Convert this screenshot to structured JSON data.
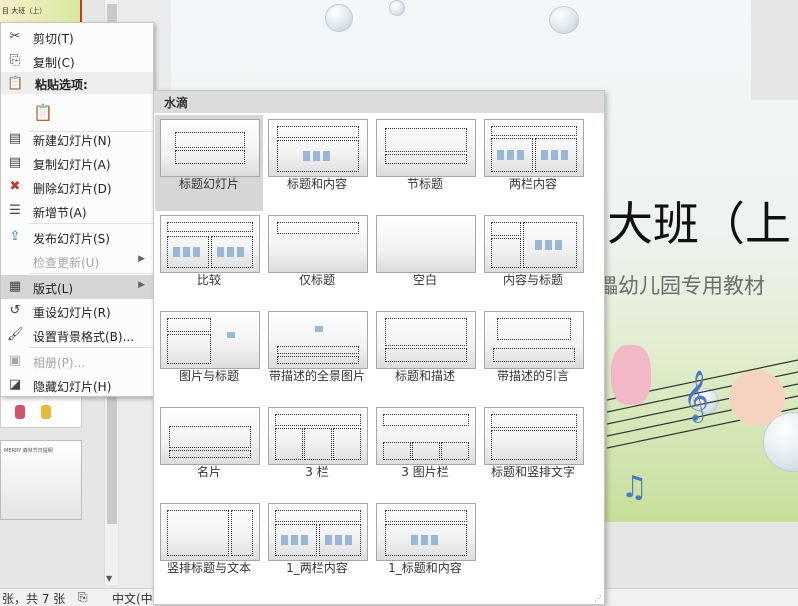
{
  "thumbnail_pane": {
    "top_thumb_text": "目  大班（上）",
    "slide7_thumb_text": "MERRY 森林节日提纲"
  },
  "slide": {
    "title": "大班（上",
    "subtitle": "儡幼儿园专用教材"
  },
  "statusbar": {
    "slide_count": "张，共 7 张",
    "language": "中文(中"
  },
  "context_menu": {
    "items": [
      {
        "label": "剪切(T)",
        "icon": "scissors-icon",
        "enabled": true
      },
      {
        "label": "复制(C)",
        "icon": "copy-icon",
        "enabled": true
      },
      {
        "label": "粘贴选项:",
        "icon": "paste-icon",
        "enabled": false
      },
      {
        "label": "新建幻灯片(N)",
        "icon": "new-slide-icon",
        "enabled": true
      },
      {
        "label": "复制幻灯片(A)",
        "icon": "duplicate-slide-icon",
        "enabled": true
      },
      {
        "label": "删除幻灯片(D)",
        "icon": "delete-slide-icon",
        "enabled": true
      },
      {
        "label": "新增节(A)",
        "icon": "add-section-icon",
        "enabled": true
      },
      {
        "label": "发布幻灯片(S)",
        "icon": "publish-slides-icon",
        "enabled": true
      },
      {
        "label": "检查更新(U)",
        "icon": "",
        "enabled": false
      },
      {
        "label": "版式(L)",
        "icon": "layout-icon",
        "enabled": true
      },
      {
        "label": "重设幻灯片(R)",
        "icon": "reset-slide-icon",
        "enabled": true
      },
      {
        "label": "设置背景格式(B)...",
        "icon": "format-background-icon",
        "enabled": true
      },
      {
        "label": "相册(P)...",
        "icon": "photo-album-icon",
        "enabled": false
      },
      {
        "label": "隐藏幻灯片(H)",
        "icon": "hide-slide-icon",
        "enabled": true
      }
    ]
  },
  "layout_gallery": {
    "header": "水滴",
    "selected": "标题幻灯片",
    "layouts": [
      "标题幻灯片",
      "标题和内容",
      "节标题",
      "两栏内容",
      "比较",
      "仅标题",
      "空白",
      "内容与标题",
      "图片与标题",
      "带描述的全景图片",
      "标题和描述",
      "带描述的引言",
      "名片",
      "3 栏",
      "3 图片栏",
      "标题和竖排文字",
      "竖排标题与文本",
      "1_两栏内容",
      "1_标题和内容"
    ]
  }
}
